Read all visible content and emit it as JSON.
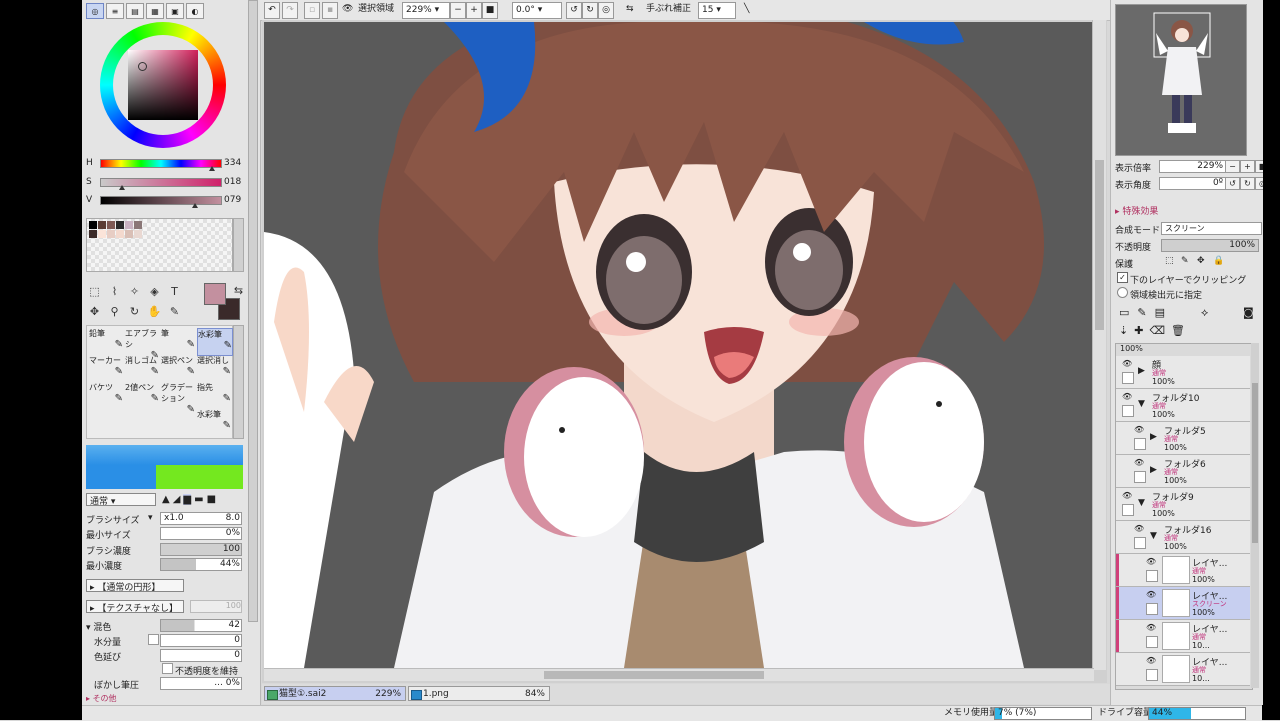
{
  "colors": {
    "hue_accent": "#c3909f",
    "selection": "#c7cff0",
    "fill_blue": "#2fb6e8"
  },
  "left_panel": {
    "sliders": [
      {
        "label": "H",
        "value": "334",
        "pos": 0.93
      },
      {
        "label": "S",
        "value": "018",
        "pos": 0.18
      },
      {
        "label": "V",
        "value": "079",
        "pos": 0.79
      }
    ],
    "swatches": [
      "#000000",
      "#5a3c34",
      "#7e5a55",
      "#2a2a2a",
      "#c9b3c2",
      "#8a7777",
      "#3c2a28",
      "#fbe4d9",
      "#e7cdc4",
      "#f3d9ce",
      "#d9bfb6",
      "#e9d8d2"
    ],
    "brushes": [
      {
        "name": "鉛筆"
      },
      {
        "name": "エアブラシ"
      },
      {
        "name": "筆"
      },
      {
        "name": "水彩筆"
      },
      {
        "name": "マーカー"
      },
      {
        "name": "消しゴム"
      },
      {
        "name": "選択ペン"
      },
      {
        "name": "選択消し"
      },
      {
        "name": "バケツ"
      },
      {
        "name": "2値ペン"
      },
      {
        "name": "グラデーション"
      },
      {
        "name": "指先"
      },
      {
        "name": ""
      },
      {
        "name": ""
      },
      {
        "name": ""
      },
      {
        "name": "水彩筆"
      }
    ],
    "blend_mode": "通常",
    "brush_size": {
      "label": "ブラシサイズ",
      "mult": "x1.0",
      "value": "8.0"
    },
    "min_size": {
      "label": "最小サイズ",
      "value": "0%"
    },
    "density": {
      "label": "ブラシ濃度",
      "value": "100"
    },
    "min_density": {
      "label": "最小濃度",
      "value": "44%"
    },
    "shape_dd": "【通常の円形】",
    "texture_dd": "【テクスチャなし】",
    "texture_strength": "100",
    "mixing": {
      "label": "混色",
      "value": "42"
    },
    "water": {
      "label": "水分量",
      "value": "0"
    },
    "color_extend": {
      "label": "色延び",
      "value": "0"
    },
    "keep_opacity": "不透明度を維持",
    "blur_pressure": {
      "label": "ぼかし筆圧",
      "value": "... 0%"
    },
    "other": "その他"
  },
  "top_toolbar": {
    "selection_label": "選択領域",
    "zoom": "229%",
    "angle": "0.0°",
    "stabilizer_label": "手ぶれ補正",
    "stabilizer_value": "15"
  },
  "doc_tabs": [
    {
      "name": "猫型①.sai2",
      "zoom": "229%"
    },
    {
      "name": "1.png",
      "zoom": "84%"
    }
  ],
  "status": {
    "memory_label": "メモリ使用量",
    "memory_value": "7% (7%)",
    "memory_pct": 0.07,
    "drive_label": "ドライブ容量",
    "drive_value": "44%",
    "drive_pct": 0.44
  },
  "right_panel": {
    "zoom_label": "表示倍率",
    "zoom_value": "229%",
    "angle_label": "表示角度",
    "angle_value": "0º",
    "effects_label": "特殊効果",
    "blend_label": "合成モード",
    "blend_value": "スクリーン",
    "opacity_label": "不透明度",
    "opacity_value": "100%",
    "protect_label": "保護",
    "clip_label": "下のレイヤーでクリッピング",
    "clip_checked": true,
    "select_source_label": "領域検出元に指定",
    "top_pct": "100%",
    "layers": [
      {
        "name": "顔",
        "mode": "通常",
        "opacity": "100%",
        "type": "folder",
        "open": false,
        "indent": 0
      },
      {
        "name": "フォルダ10",
        "mode": "通常",
        "opacity": "100%",
        "type": "folder",
        "open": true,
        "indent": 0
      },
      {
        "name": "フォルダ5",
        "mode": "通常",
        "opacity": "100%",
        "type": "folder",
        "open": false,
        "indent": 1
      },
      {
        "name": "フォルダ6",
        "mode": "通常",
        "opacity": "100%",
        "type": "folder",
        "open": false,
        "indent": 1
      },
      {
        "name": "フォルダ9",
        "mode": "通常",
        "opacity": "100%",
        "type": "folder",
        "open": true,
        "indent": 0
      },
      {
        "name": "フォルダ16",
        "mode": "通常",
        "opacity": "100%",
        "type": "folder",
        "open": true,
        "indent": 1
      },
      {
        "name": "レイヤ...",
        "mode": "通常",
        "opacity": "100%",
        "type": "layer",
        "clip": true,
        "indent": 2
      },
      {
        "name": "レイヤ...",
        "mode": "スクリーン",
        "opacity": "100%",
        "type": "layer",
        "clip": true,
        "selected": true,
        "indent": 2
      },
      {
        "name": "レイヤ...",
        "mode": "通常",
        "opacity": "10...",
        "type": "layer",
        "clip": true,
        "indent": 2
      },
      {
        "name": "レイヤ...",
        "mode": "通常",
        "opacity": "10...",
        "type": "layer",
        "clip": false,
        "indent": 2
      }
    ]
  }
}
